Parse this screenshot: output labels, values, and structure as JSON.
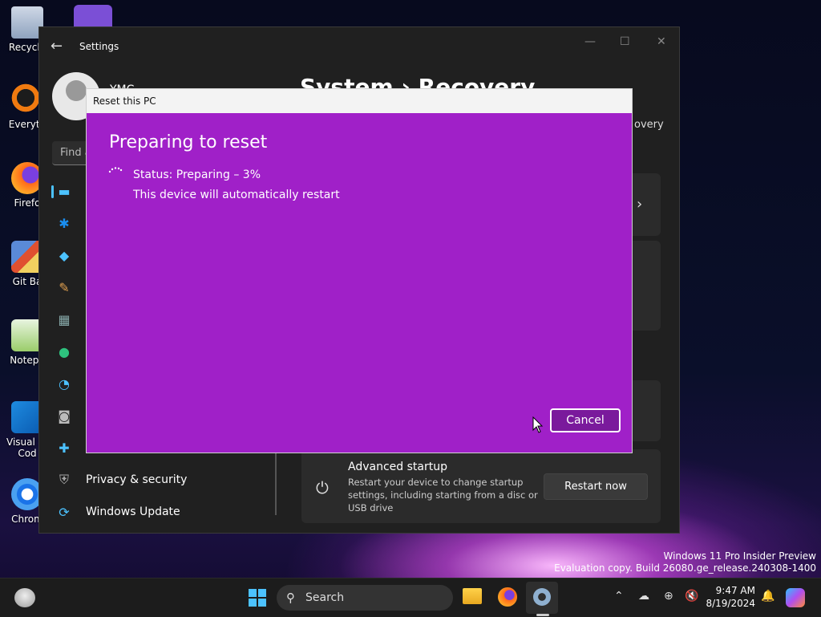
{
  "desktop": {
    "icons": [
      {
        "label": "Recycle",
        "icon": "recycle-bin-icon"
      },
      {
        "label": "Everyth",
        "icon": "everything-search-icon"
      },
      {
        "label": "Firefo",
        "icon": "firefox-icon"
      },
      {
        "label": "Git Ba",
        "icon": "git-bash-icon"
      },
      {
        "label": "Notepa",
        "icon": "notepad-icon"
      },
      {
        "label": "Visual St\nCod",
        "icon": "vscode-icon"
      },
      {
        "label": "Chrom",
        "icon": "chrome-icon"
      }
    ],
    "watermark_line1": "Windows 11 Pro Insider Preview",
    "watermark_line2": "Evaluation copy. Build 26080.ge_release.240308-1400"
  },
  "settings": {
    "app_title": "Settings",
    "user_name": "YMC",
    "find_placeholder": "Find a",
    "headline": "System  ›  Recovery",
    "crumb_right": "overy",
    "nav_icons": [
      "system-icon",
      "bluetooth-icon",
      "wifi-icon",
      "personalization-brush-icon",
      "apps-icon",
      "accounts-icon",
      "time-language-icon",
      "gaming-icon",
      "accessibility-icon"
    ],
    "privacy_label": "Privacy & security",
    "update_label": "Windows Update",
    "advanced": {
      "title": "Advanced startup",
      "description": "Restart your device to change startup settings, including starting from a disc or USB drive",
      "button": "Restart now"
    }
  },
  "dialog": {
    "title": "Reset this PC",
    "heading": "Preparing to reset",
    "status": "Status: Preparing – 3%",
    "message": "This device will automatically restart",
    "cancel": "Cancel",
    "progress_percent": 3,
    "background_color": "#a020c8"
  },
  "taskbar": {
    "search_label": "Search",
    "time": "9:47 AM",
    "date": "8/19/2024"
  }
}
